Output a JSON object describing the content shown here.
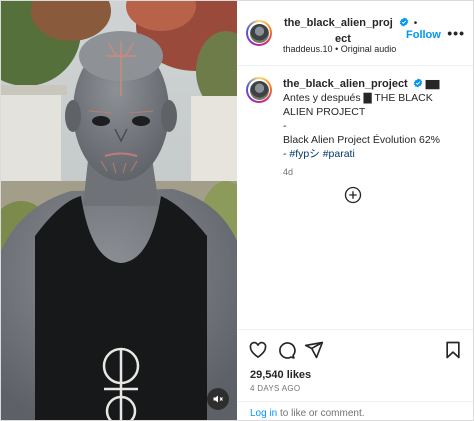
{
  "post": {
    "username": "the_black_alien_proj",
    "username_cont": "ect",
    "follow_label": "Follow",
    "separator": "•",
    "audio_user": "thaddeus.10",
    "audio_label": "Original audio",
    "more_label": "•••"
  },
  "caption": {
    "username": "the_black_alien_project",
    "flag": "▇▇",
    "line1": "Antes y después ▇ THE BLACK",
    "line2": "ALIEN PROJECT",
    "line3": "-",
    "line4": "Black Alien Project Évolution 62%",
    "line5_prefix": "- ",
    "hashtags": [
      "#fypシ",
      "#parati"
    ],
    "age": "4d"
  },
  "footer": {
    "likes": "29,540 likes",
    "date": "4 DAYS AGO",
    "login_link": "Log in",
    "login_rest": " to like or comment."
  },
  "icons": {
    "verified": "verified-badge-icon",
    "plus": "plus-circle-icon",
    "heart": "heart-icon",
    "comment": "comment-icon",
    "share": "share-icon",
    "save": "bookmark-icon",
    "mute": "speaker-muted-icon"
  },
  "colors": {
    "accent": "#0095f6",
    "hashtag": "#00376b",
    "muted_text": "#737373",
    "border": "#dbdbdb"
  }
}
